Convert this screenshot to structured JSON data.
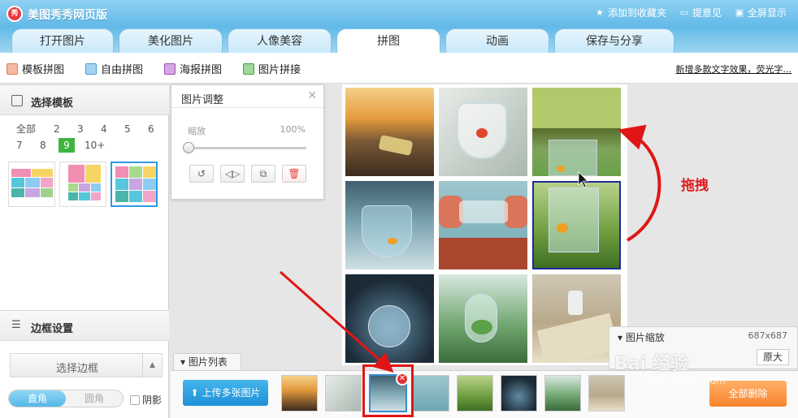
{
  "app": {
    "title": "美图秀秀网页版",
    "logo_text": "秀"
  },
  "top_links": [
    {
      "label": "添加到收藏夹",
      "icon": "star-icon"
    },
    {
      "label": "提意见",
      "icon": "comment-icon"
    },
    {
      "label": "全屏显示",
      "icon": "fullscreen-icon"
    }
  ],
  "tabs": [
    "打开图片",
    "美化图片",
    "人像美容",
    "拼图",
    "动画",
    "保存与分享"
  ],
  "active_tab": "拼图",
  "subnav": {
    "items": [
      "模板拼图",
      "自由拼图",
      "海报拼图",
      "图片拼接"
    ],
    "news_link": "新增多款文字效果，荧光字..."
  },
  "template_panel": {
    "title": "选择模板",
    "counts": [
      "全部",
      "2",
      "3",
      "4",
      "5",
      "6",
      "7",
      "8",
      "9",
      "10+"
    ],
    "selected_count": "9"
  },
  "border_panel": {
    "title": "边框设置",
    "select_label": "选择边框",
    "corner_square": "直角",
    "corner_round": "圆角",
    "shadow_label": "阴影"
  },
  "adjust_panel": {
    "title": "图片调整",
    "zoom_label": "缩放",
    "zoom_value": "100%",
    "zoom_level": 0
  },
  "zoom_panel": {
    "title": "图片缩放",
    "size": "687x687",
    "original_label": "原大"
  },
  "annotation": {
    "drag_label": "拖拽"
  },
  "picture_list": {
    "tab_label": "图片列表",
    "upload_label": "上传多张图片",
    "delete_all_label": "全部删除"
  },
  "watermark": {
    "brand": "Bai 经验",
    "url": "jingyan.baidu.com"
  },
  "colors": {
    "accent": "#2e9be0",
    "select_green": "#3fb53f",
    "annotation_red": "#e01616",
    "delete_orange": "#f8842d"
  }
}
